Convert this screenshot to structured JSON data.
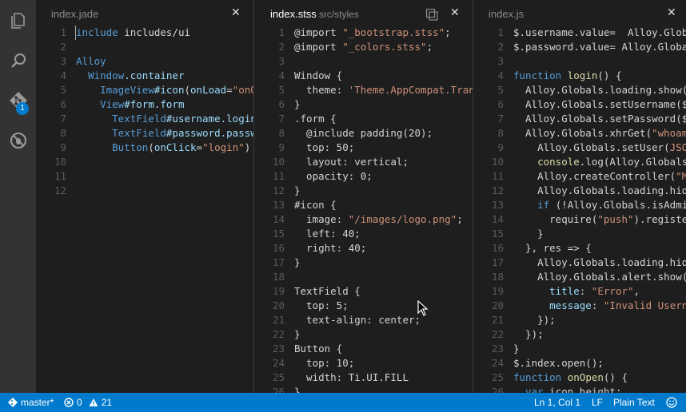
{
  "activity_bar": {
    "items": [
      {
        "name": "explorer-icon"
      },
      {
        "name": "search-icon"
      },
      {
        "name": "git-icon",
        "badge": "1"
      },
      {
        "name": "debug-icon"
      }
    ]
  },
  "panes": [
    {
      "tab": {
        "title": "index.jade",
        "path": ""
      },
      "lines": [
        {
          "n": "1",
          "t": [
            {
              "c": "kw",
              "s": "include"
            },
            {
              "c": "",
              "s": " includes/ui"
            }
          ]
        },
        {
          "n": "2",
          "t": []
        },
        {
          "n": "3",
          "t": [
            {
              "c": "tag",
              "s": "Alloy"
            }
          ]
        },
        {
          "n": "4",
          "t": [
            {
              "c": "",
              "s": "  "
            },
            {
              "c": "tag",
              "s": "Window"
            },
            {
              "c": "id",
              "s": ".container"
            }
          ]
        },
        {
          "n": "5",
          "t": [
            {
              "c": "",
              "s": "    "
            },
            {
              "c": "tag",
              "s": "ImageView"
            },
            {
              "c": "id",
              "s": "#icon"
            },
            {
              "c": "",
              "s": "("
            },
            {
              "c": "attr",
              "s": "onLoad"
            },
            {
              "c": "",
              "s": "="
            },
            {
              "c": "str",
              "s": "\"onOp"
            }
          ]
        },
        {
          "n": "6",
          "t": [
            {
              "c": "",
              "s": "    "
            },
            {
              "c": "tag",
              "s": "View"
            },
            {
              "c": "id",
              "s": "#form.form"
            }
          ]
        },
        {
          "n": "7",
          "t": [
            {
              "c": "",
              "s": "      "
            },
            {
              "c": "tag",
              "s": "TextField"
            },
            {
              "c": "id",
              "s": "#username.login"
            }
          ]
        },
        {
          "n": "8",
          "t": [
            {
              "c": "",
              "s": "      "
            },
            {
              "c": "tag",
              "s": "TextField"
            },
            {
              "c": "id",
              "s": "#password.passwo"
            }
          ]
        },
        {
          "n": "9",
          "t": [
            {
              "c": "",
              "s": "      "
            },
            {
              "c": "tag",
              "s": "Button"
            },
            {
              "c": "",
              "s": "("
            },
            {
              "c": "attr",
              "s": "onClick"
            },
            {
              "c": "",
              "s": "="
            },
            {
              "c": "str",
              "s": "\"login\""
            },
            {
              "c": "",
              "s": ") L"
            }
          ]
        },
        {
          "n": "10",
          "t": []
        },
        {
          "n": "11",
          "t": []
        },
        {
          "n": "12",
          "t": []
        }
      ]
    },
    {
      "tab": {
        "title": "index.stss",
        "path": "src/styles"
      },
      "lines": [
        {
          "n": "1",
          "t": [
            {
              "c": "",
              "s": "@import "
            },
            {
              "c": "str",
              "s": "\"_bootstrap.stss\""
            },
            {
              "c": "",
              "s": ";"
            }
          ]
        },
        {
          "n": "2",
          "t": [
            {
              "c": "",
              "s": "@import "
            },
            {
              "c": "str",
              "s": "\"_colors.stss\""
            },
            {
              "c": "",
              "s": ";"
            }
          ]
        },
        {
          "n": "3",
          "t": []
        },
        {
          "n": "4",
          "t": [
            {
              "c": "",
              "s": "Window {"
            }
          ]
        },
        {
          "n": "5",
          "t": [
            {
              "c": "",
              "s": "  theme: "
            },
            {
              "c": "str",
              "s": "'Theme.AppCompat.Trans"
            }
          ]
        },
        {
          "n": "6",
          "t": [
            {
              "c": "",
              "s": "}"
            }
          ]
        },
        {
          "n": "7",
          "t": [
            {
              "c": "",
              "s": ".form {"
            }
          ]
        },
        {
          "n": "8",
          "t": [
            {
              "c": "",
              "s": "  @include padding(20);"
            }
          ]
        },
        {
          "n": "9",
          "t": [
            {
              "c": "",
              "s": "  top: 50;"
            }
          ]
        },
        {
          "n": "10",
          "t": [
            {
              "c": "",
              "s": "  layout: vertical;"
            }
          ]
        },
        {
          "n": "11",
          "t": [
            {
              "c": "",
              "s": "  opacity: 0;"
            }
          ]
        },
        {
          "n": "12",
          "t": [
            {
              "c": "",
              "s": "}"
            }
          ]
        },
        {
          "n": "13",
          "t": [
            {
              "c": "",
              "s": "#icon {"
            }
          ]
        },
        {
          "n": "14",
          "t": [
            {
              "c": "",
              "s": "  image: "
            },
            {
              "c": "str",
              "s": "\"/images/logo.png\""
            },
            {
              "c": "",
              "s": ";"
            }
          ]
        },
        {
          "n": "15",
          "t": [
            {
              "c": "",
              "s": "  left: 40;"
            }
          ]
        },
        {
          "n": "16",
          "t": [
            {
              "c": "",
              "s": "  right: 40;"
            }
          ]
        },
        {
          "n": "17",
          "t": [
            {
              "c": "",
              "s": "}"
            }
          ]
        },
        {
          "n": "18",
          "t": []
        },
        {
          "n": "19",
          "t": [
            {
              "c": "",
              "s": "TextField {"
            }
          ]
        },
        {
          "n": "20",
          "t": [
            {
              "c": "",
              "s": "  top: 5;"
            }
          ]
        },
        {
          "n": "21",
          "t": [
            {
              "c": "",
              "s": "  text-align: center;"
            }
          ]
        },
        {
          "n": "22",
          "t": [
            {
              "c": "",
              "s": "}"
            }
          ]
        },
        {
          "n": "23",
          "t": [
            {
              "c": "",
              "s": "Button {"
            }
          ]
        },
        {
          "n": "24",
          "t": [
            {
              "c": "",
              "s": "  top: 10;"
            }
          ]
        },
        {
          "n": "25",
          "t": [
            {
              "c": "",
              "s": "  width: Ti.UI.FILL"
            }
          ]
        },
        {
          "n": "26",
          "t": [
            {
              "c": "",
              "s": "}"
            }
          ]
        }
      ]
    },
    {
      "tab": {
        "title": "index.js",
        "path": ""
      },
      "lines": [
        {
          "n": "1",
          "t": [
            {
              "c": "",
              "s": "$.username.value=  Alloy.Globa"
            }
          ]
        },
        {
          "n": "2",
          "t": [
            {
              "c": "",
              "s": "$.password.value= Alloy.Global"
            }
          ]
        },
        {
          "n": "3",
          "t": []
        },
        {
          "n": "4",
          "t": [
            {
              "c": "kw",
              "s": "function"
            },
            {
              "c": "",
              "s": " "
            },
            {
              "c": "fn",
              "s": "login"
            },
            {
              "c": "",
              "s": "() {"
            }
          ]
        },
        {
          "n": "5",
          "t": [
            {
              "c": "",
              "s": "  Alloy.Globals.loading.show("
            },
            {
              "c": "str",
              "s": "'"
            }
          ]
        },
        {
          "n": "6",
          "t": [
            {
              "c": "",
              "s": "  Alloy.Globals.setUsername($."
            }
          ]
        },
        {
          "n": "7",
          "t": [
            {
              "c": "",
              "s": "  Alloy.Globals.setPassword($."
            }
          ]
        },
        {
          "n": "8",
          "t": [
            {
              "c": "",
              "s": "  Alloy.Globals.xhrGet("
            },
            {
              "c": "str",
              "s": "\"whoami"
            }
          ]
        },
        {
          "n": "9",
          "t": [
            {
              "c": "",
              "s": "    Alloy.Globals.setUser("
            },
            {
              "c": "str",
              "s": "JSON"
            }
          ]
        },
        {
          "n": "10",
          "t": [
            {
              "c": "",
              "s": "    "
            },
            {
              "c": "fn",
              "s": "console"
            },
            {
              "c": "",
              "s": ".log(Alloy.Globals."
            }
          ]
        },
        {
          "n": "11",
          "t": [
            {
              "c": "",
              "s": "    Alloy.createController("
            },
            {
              "c": "str",
              "s": "\"Ma"
            }
          ]
        },
        {
          "n": "12",
          "t": [
            {
              "c": "",
              "s": "    Alloy.Globals.loading.hide"
            }
          ]
        },
        {
          "n": "13",
          "t": [
            {
              "c": "",
              "s": "    "
            },
            {
              "c": "kw",
              "s": "if"
            },
            {
              "c": "",
              "s": " (!Alloy.Globals.isAdmin"
            }
          ]
        },
        {
          "n": "14",
          "t": [
            {
              "c": "",
              "s": "      require("
            },
            {
              "c": "str",
              "s": "\"push\""
            },
            {
              "c": "",
              "s": ").register"
            }
          ]
        },
        {
          "n": "15",
          "t": [
            {
              "c": "",
              "s": "    }"
            }
          ]
        },
        {
          "n": "16",
          "t": [
            {
              "c": "",
              "s": "  }, res => {"
            }
          ]
        },
        {
          "n": "17",
          "t": [
            {
              "c": "",
              "s": "    Alloy.Globals.loading.hide"
            }
          ]
        },
        {
          "n": "18",
          "t": [
            {
              "c": "",
              "s": "    Alloy.Globals.alert.show({"
            }
          ]
        },
        {
          "n": "19",
          "t": [
            {
              "c": "",
              "s": "      "
            },
            {
              "c": "attr",
              "s": "title"
            },
            {
              "c": "",
              "s": ": "
            },
            {
              "c": "str",
              "s": "\"Error\""
            },
            {
              "c": "",
              "s": ","
            }
          ]
        },
        {
          "n": "20",
          "t": [
            {
              "c": "",
              "s": "      "
            },
            {
              "c": "attr",
              "s": "message"
            },
            {
              "c": "",
              "s": ": "
            },
            {
              "c": "str",
              "s": "\"Invalid Userna"
            }
          ]
        },
        {
          "n": "21",
          "t": [
            {
              "c": "",
              "s": "    });"
            }
          ]
        },
        {
          "n": "22",
          "t": [
            {
              "c": "",
              "s": "  });"
            }
          ]
        },
        {
          "n": "23",
          "t": [
            {
              "c": "",
              "s": "}"
            }
          ]
        },
        {
          "n": "24",
          "t": [
            {
              "c": "",
              "s": "$.index.open();"
            }
          ]
        },
        {
          "n": "25",
          "t": [
            {
              "c": "kw",
              "s": "function"
            },
            {
              "c": "",
              "s": " "
            },
            {
              "c": "fn",
              "s": "onOpen"
            },
            {
              "c": "",
              "s": "() {"
            }
          ]
        },
        {
          "n": "26",
          "t": [
            {
              "c": "",
              "s": "  "
            },
            {
              "c": "kw",
              "s": "var"
            },
            {
              "c": "",
              "s": " icon_height;"
            }
          ]
        }
      ]
    }
  ],
  "status": {
    "branch": "master*",
    "errors": "0",
    "warnings": "21",
    "position": "Ln 1, Col 1",
    "eol": "LF",
    "language": "Plain Text"
  },
  "colors": {
    "accent": "#007acc",
    "editor_bg": "#1e1e1e",
    "activitybar_bg": "#333333"
  }
}
